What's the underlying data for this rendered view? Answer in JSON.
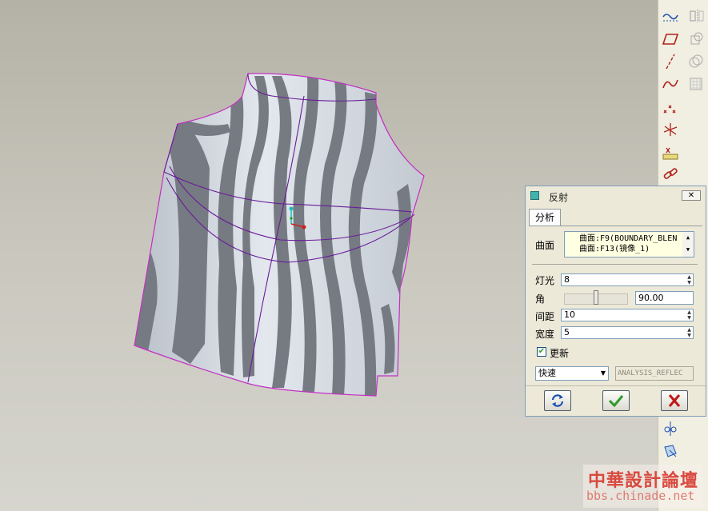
{
  "dialog": {
    "title": "反射",
    "close_label": "✕",
    "tab": "分析",
    "surface_label": "曲面",
    "surfaces": [
      "曲面:F9(BOUNDARY_BLEN",
      "曲面:F13(镜像_1)"
    ],
    "lights_label": "灯光",
    "lights_value": "8",
    "angle_label": "角",
    "angle_value": "90.00",
    "angle_slider_fraction": 0.5,
    "spacing_label": "间距",
    "spacing_value": "10",
    "width_label": "宽度",
    "width_value": "5",
    "update_label": "更新",
    "update_checked": true,
    "mode_value": "快速",
    "analysis_name": "ANALYSIS_REFLEC"
  },
  "watermark": {
    "text_cn": "中華設計論壇",
    "url": "bbs.chinade.net"
  },
  "colors": {
    "accent": "#c330c3",
    "dialog_bg": "#ece9d8",
    "stripe_dark": "#7a7d84",
    "surface_light": "#d7dde4",
    "ok_green": "#2c9a2c",
    "cancel_red": "#c01818"
  },
  "toolbar": {
    "icons": [
      "sketch-datum-icon",
      "mirror-icon",
      "plane-icon",
      "shell-icon",
      "axis-icon",
      "offset-icon",
      "curve-icon",
      "pattern-icon",
      "point-icon",
      "coordinate-system-icon",
      "analysis-ruler-icon",
      "chain-link-icon",
      "annotation-icon",
      "select-icon"
    ]
  }
}
